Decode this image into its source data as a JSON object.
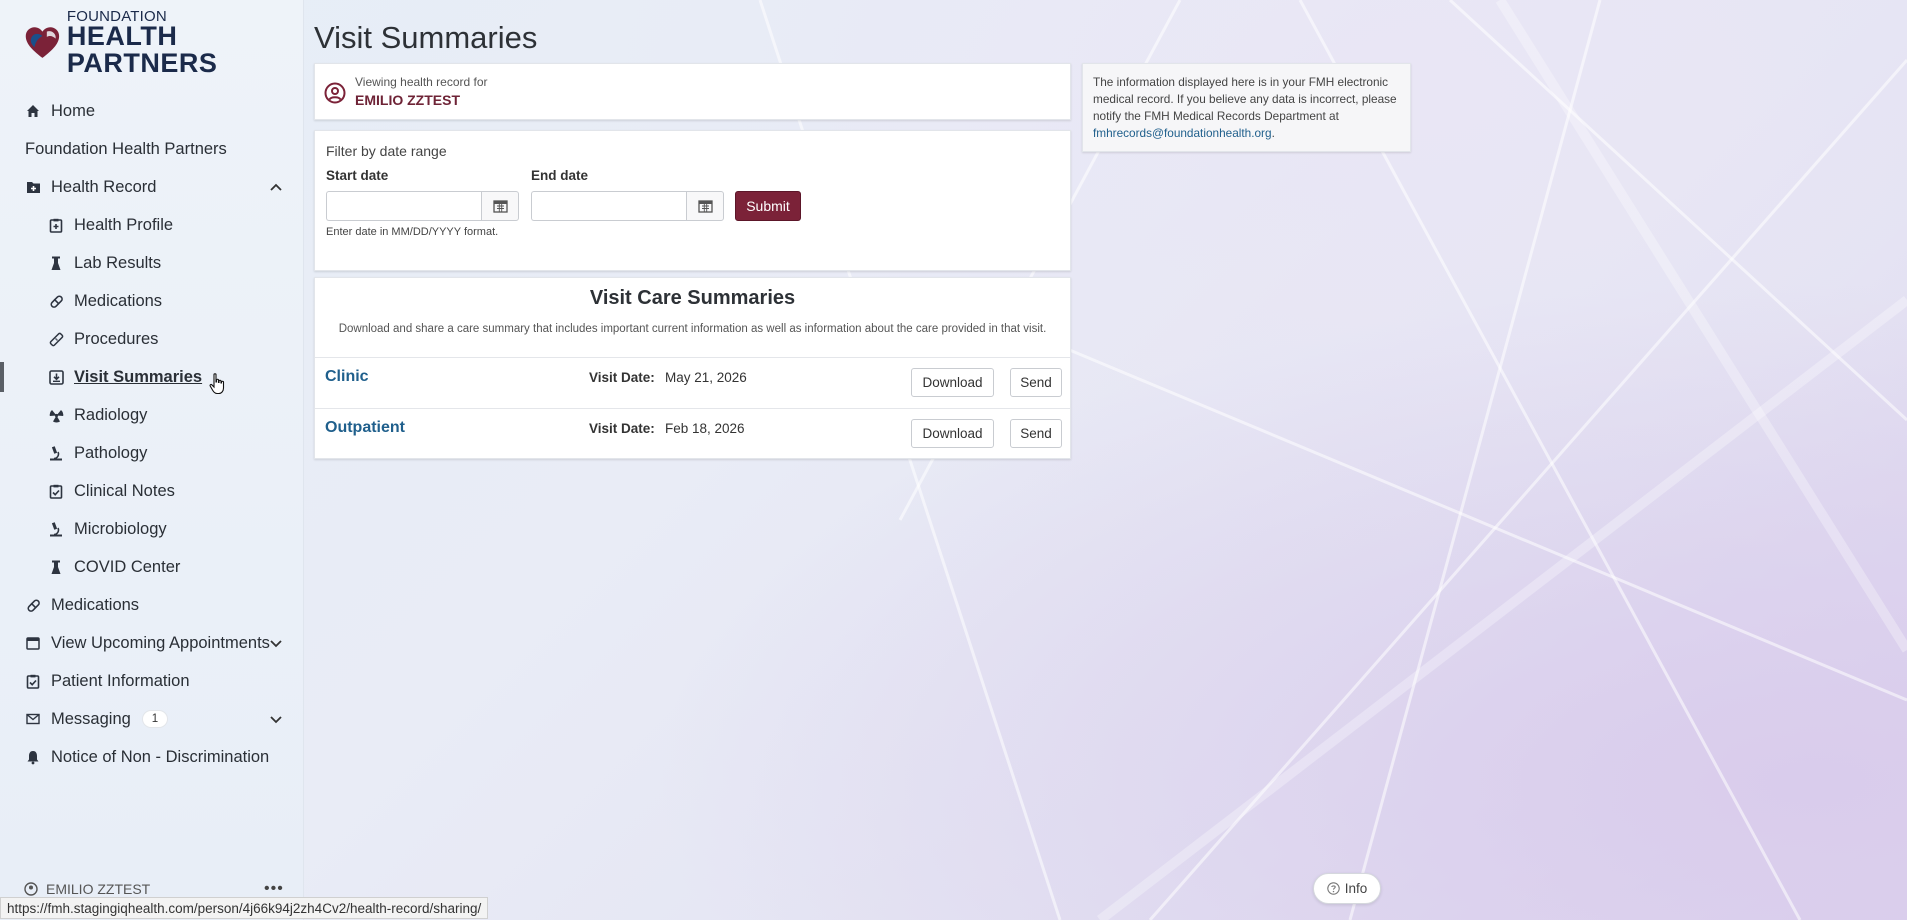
{
  "brand": {
    "logo_small": "FOUNDATION",
    "logo_big": "HEALTH PARTNERS"
  },
  "sidebar": {
    "items": [
      {
        "label": "Home",
        "icon": "home-icon"
      },
      {
        "label": "Foundation Health Partners"
      },
      {
        "label": "Health Record",
        "icon": "folder-icon",
        "expanded": true
      },
      {
        "label": "Health Profile",
        "icon": "clipboard-plus-icon"
      },
      {
        "label": "Lab Results",
        "icon": "flask-icon"
      },
      {
        "label": "Medications",
        "icon": "pill-icon"
      },
      {
        "label": "Procedures",
        "icon": "bandage-icon"
      },
      {
        "label": "Visit Summaries",
        "icon": "download-box-icon",
        "active": true
      },
      {
        "label": "Radiology",
        "icon": "radiation-icon"
      },
      {
        "label": "Pathology",
        "icon": "microscope-icon"
      },
      {
        "label": "Clinical Notes",
        "icon": "clipboard-check-icon"
      },
      {
        "label": "Microbiology",
        "icon": "microscope-icon"
      },
      {
        "label": "COVID Center",
        "icon": "flask-icon"
      },
      {
        "label": "Medications",
        "icon": "pill-icon"
      },
      {
        "label": "View Upcoming Appointments",
        "icon": "calendar-icon"
      },
      {
        "label": "Patient Information",
        "icon": "clipboard-check-icon"
      },
      {
        "label": "Messaging",
        "icon": "envelope-icon",
        "badge": "1"
      },
      {
        "label": "Notice of Non - Discrimination",
        "icon": "bell-icon"
      }
    ],
    "user_name": "EMILIO ZZTEST"
  },
  "page": {
    "title": "Visit Summaries"
  },
  "viewing": {
    "caption": "Viewing health record for",
    "patient": "EMILIO ZZTEST"
  },
  "filter": {
    "title": "Filter by date range",
    "start_label": "Start date",
    "end_label": "End date",
    "start_value": "",
    "end_value": "",
    "submit": "Submit",
    "hint": "Enter date in MM/DD/YYYY format."
  },
  "summaries": {
    "title": "Visit Care Summaries",
    "description": "Download and share a care summary that includes important current information as well as information about the care provided in that visit.",
    "visit_date_label": "Visit Date:",
    "download_label": "Download",
    "send_label": "Send",
    "rows": [
      {
        "type": "Clinic",
        "date": "May 21, 2026"
      },
      {
        "type": "Outpatient",
        "date": "Feb 18, 2026"
      }
    ]
  },
  "info_box": {
    "text": "The information displayed here is in your FMH electronic medical record. If you believe any data is incorrect, please notify the FMH Medical Records Department at",
    "email": "fmhrecords@foundationhealth.org",
    "suffix": "."
  },
  "info_button": "Info",
  "status_url": "https://fmh.stagingiqhealth.com/person/4j66k94j2zh4Cv2/health-record/sharing/",
  "colors": {
    "brand_maroon": "#7b2238",
    "link_blue": "#1f5f8c"
  }
}
